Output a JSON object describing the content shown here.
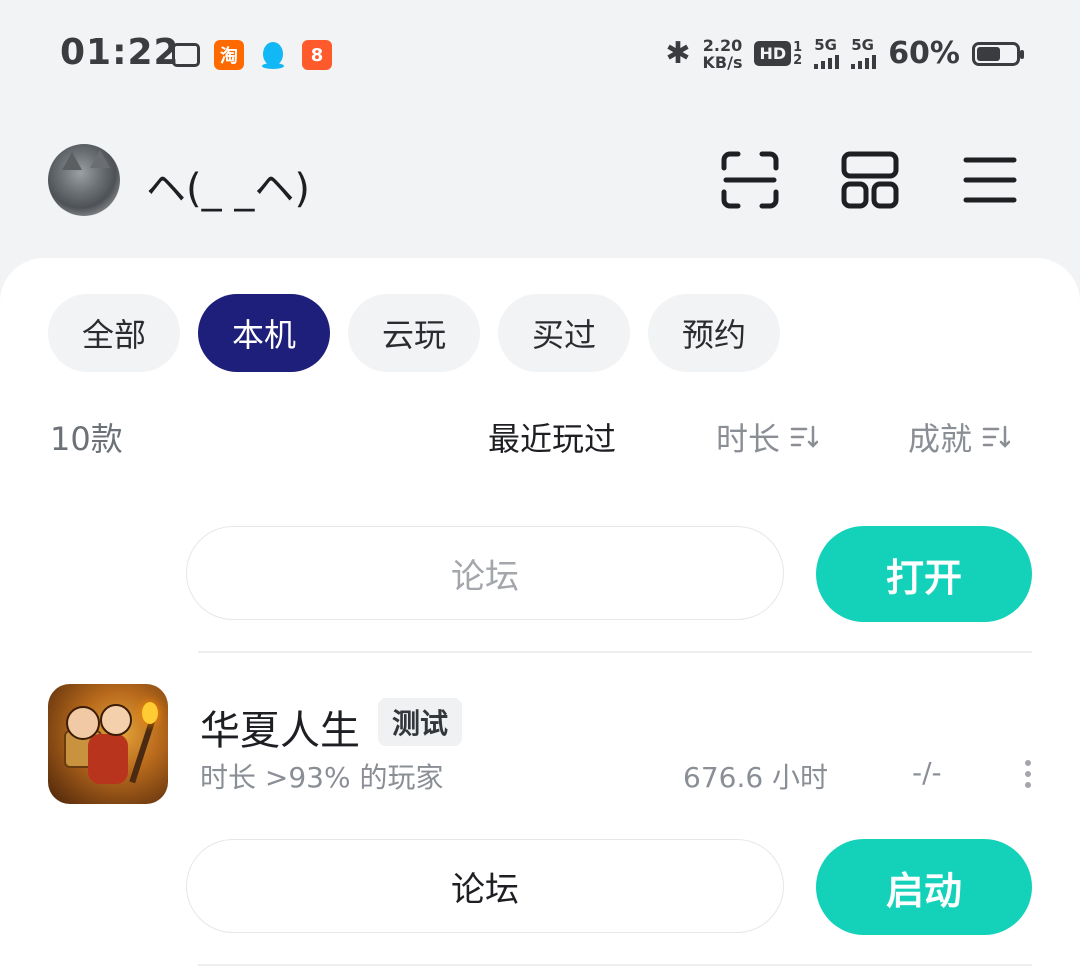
{
  "status_bar": {
    "time": "01:22",
    "net_speed_value": "2.20",
    "net_speed_unit": "KB/s",
    "hd_label": "HD",
    "hd_superscript": "1",
    "hd_subscript": "2",
    "sig1_label": "5G",
    "sig2_label": "5G",
    "battery_text": "60%",
    "battery_level": 0.6,
    "notification_icons": [
      "tv-icon",
      "taobao-icon",
      "qq-penguin-icon",
      "kuaishou-icon"
    ],
    "taobao_glyph": "淘",
    "kuai_glyph": "8"
  },
  "header": {
    "username": "ヘ(_ _ヘ)"
  },
  "filters": [
    "全部",
    "本机",
    "云玩",
    "买过",
    "预约"
  ],
  "active_filter_index": 1,
  "sortbar": {
    "count": "10款",
    "recent": "最近玩过",
    "duration": "时长",
    "achievement": "成就"
  },
  "items": [
    {
      "forum_label": "论坛",
      "action_label": "打开"
    },
    {
      "name": "华夏人生",
      "tag": "测试",
      "subtitle": "时长 >93% 的玩家",
      "hours": "676.6 小时",
      "achievement": "-/-",
      "forum_label": "论坛",
      "action_label": "启动"
    }
  ],
  "colors": {
    "accent_teal": "#14d2b9",
    "active_chip": "#1e1f7a",
    "page_bg": "#f2f3f5"
  }
}
